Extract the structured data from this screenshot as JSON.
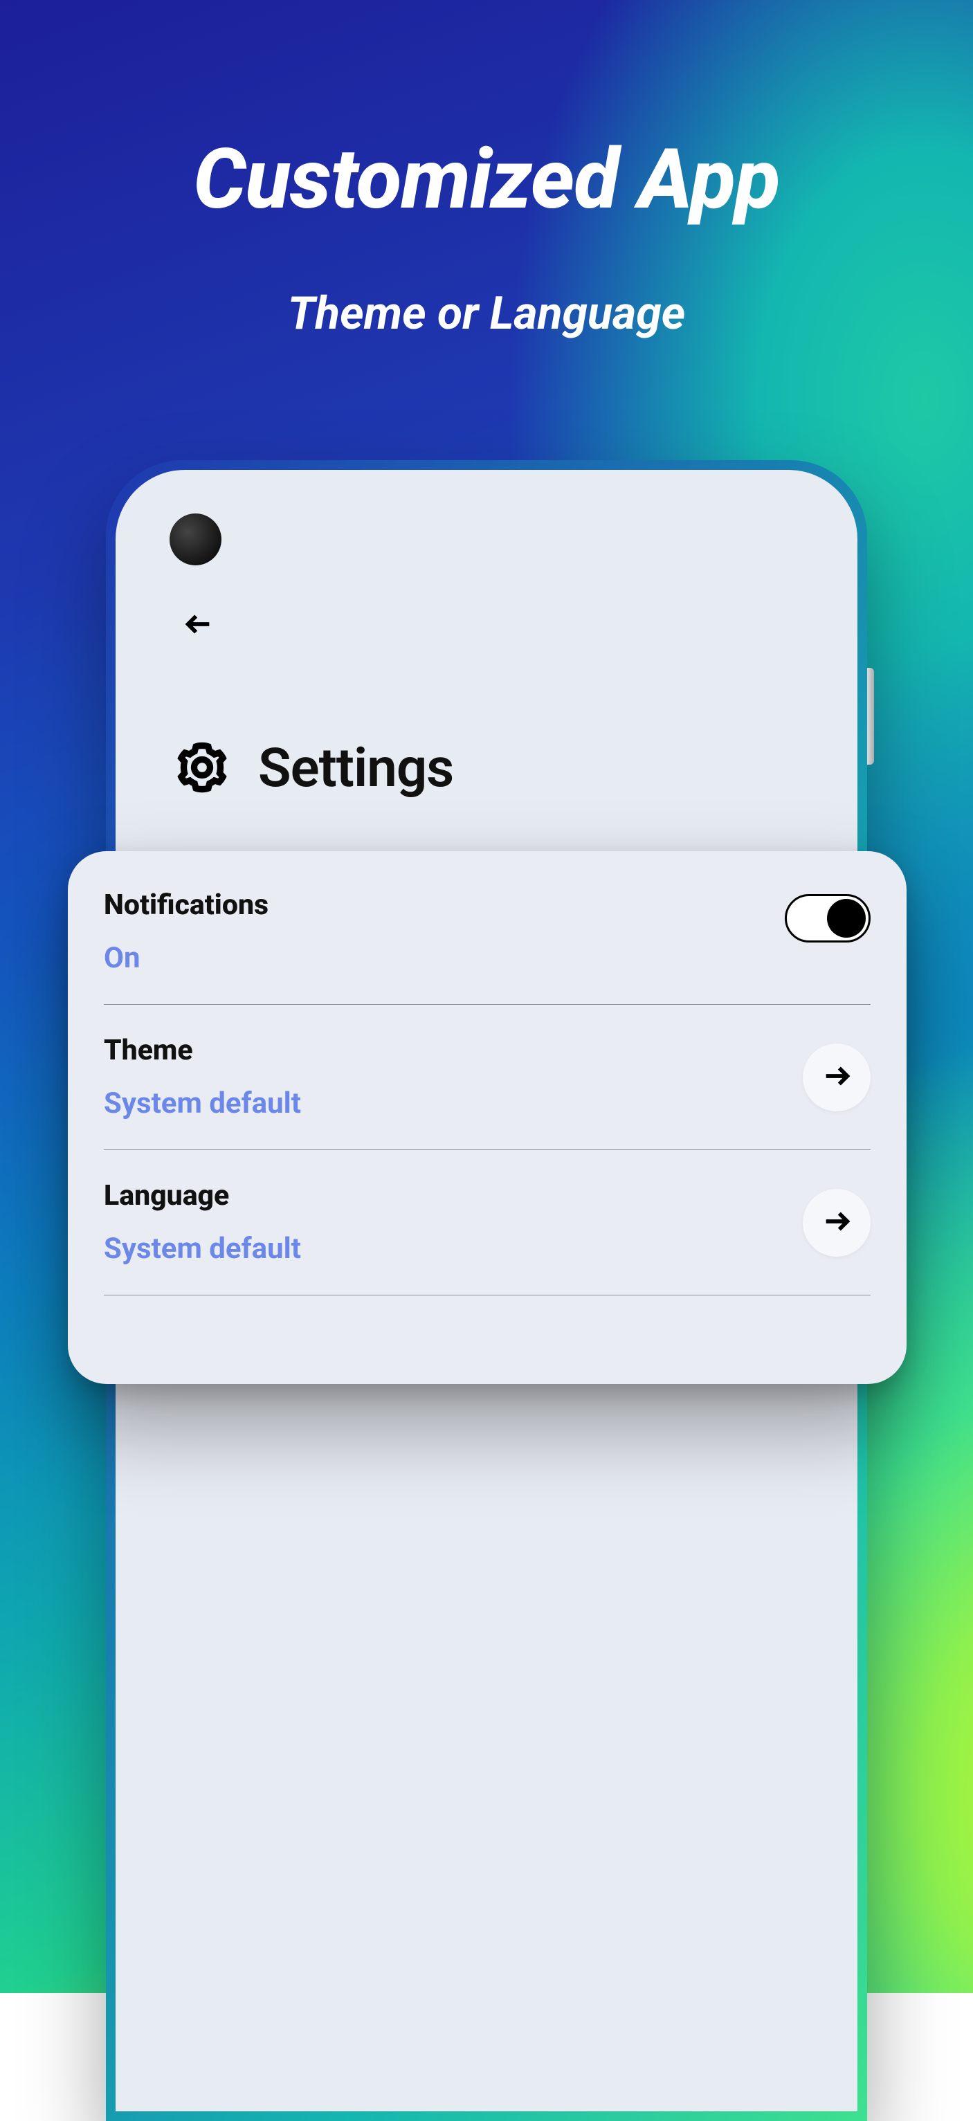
{
  "promo": {
    "headline": "Customized App",
    "subhead": "Theme or Language"
  },
  "app": {
    "title": "Settings"
  },
  "settings": {
    "notifications": {
      "label": "Notifications",
      "value": "On",
      "toggle_on": true
    },
    "theme": {
      "label": "Theme",
      "value": "System default"
    },
    "language": {
      "label": "Language",
      "value": "System default"
    }
  },
  "colors": {
    "accent_text": "#6b87e8"
  }
}
